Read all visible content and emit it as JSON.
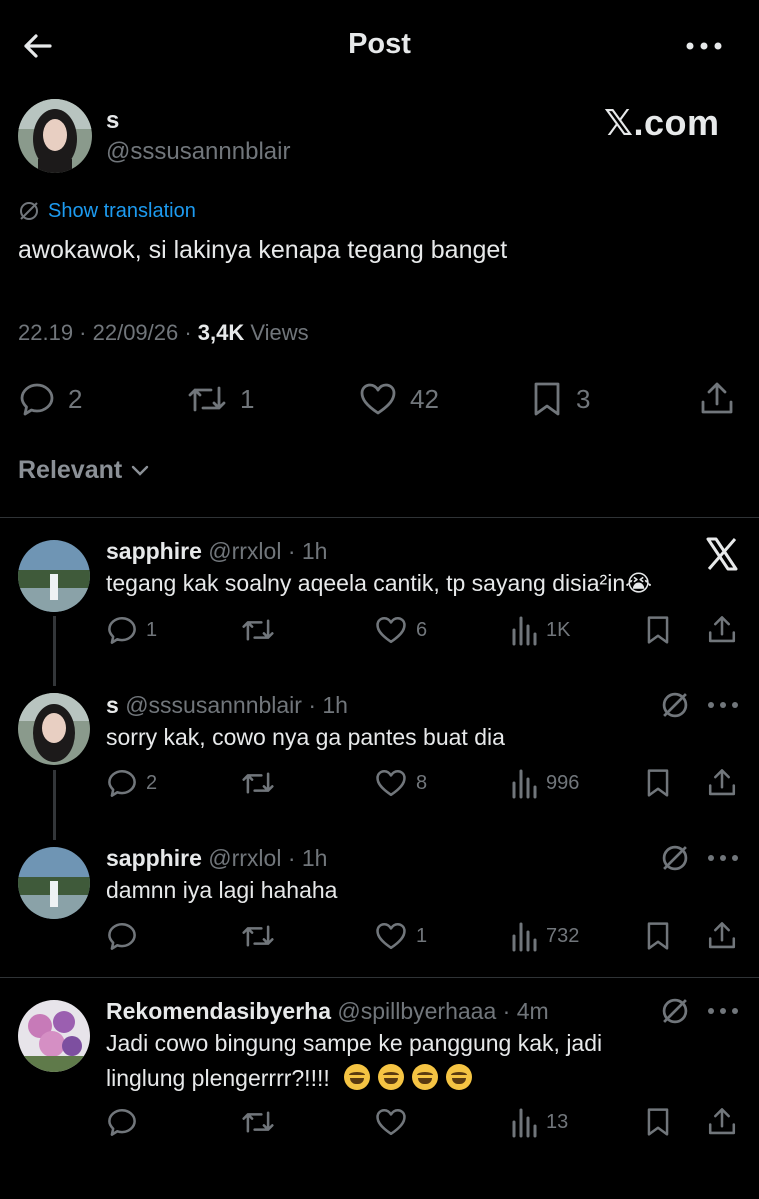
{
  "header": {
    "title": "Post"
  },
  "post": {
    "name": "s",
    "handle": "@sssusannnblair",
    "watermark": "𝕏.com",
    "translate_label": "Show translation",
    "text": "awokawok, si lakinya kenapa tegang banget",
    "time": "22.19 · 22/09/26 · ",
    "views_count": "3,4K",
    "views_label": " Views",
    "replies": "2",
    "reposts": "1",
    "likes": "42",
    "bookmarks": "3"
  },
  "sort": {
    "label": "Relevant"
  },
  "replies": [
    {
      "name": "sapphire",
      "handle": "@rrxlol · 1h",
      "text": "tegang kak soalny aqeela cantik, tp sayang disia²in😭",
      "replies": "1",
      "reposts": "",
      "likes": "6",
      "views": "1K"
    },
    {
      "name": "s",
      "handle": "@sssusannnblair · 1h",
      "text": "sorry kak, cowo nya ga pantes buat dia",
      "replies": "2",
      "reposts": "",
      "likes": "8",
      "views": "996"
    },
    {
      "name": "sapphire",
      "handle": "@rrxlol · 1h",
      "text": "damnn iya lagi hahaha",
      "replies": "",
      "reposts": "",
      "likes": "1",
      "views": "732"
    },
    {
      "name": "Rekomendasibyerha",
      "handle": "@spillbyerhaaa · 4m",
      "text_line1": "Jadi cowo bingung sampe ke panggung kak, jadi",
      "text_line2": "linglung plengerrrr?!!!! ",
      "replies": "",
      "reposts": "",
      "likes": "",
      "views": "13"
    }
  ],
  "colors": {
    "background": "#000000",
    "text": "#e7e9ea",
    "muted": "#71767b",
    "link": "#1d9bf0",
    "divider": "#2f3336"
  },
  "icons": [
    "back-arrow-icon",
    "more-icon",
    "translate-icon",
    "reply-icon",
    "retweet-icon",
    "like-icon",
    "bookmark-icon",
    "share-icon",
    "views-icon",
    "x-logo-icon",
    "chevron-down-icon",
    "rofl-emoji-icon"
  ]
}
